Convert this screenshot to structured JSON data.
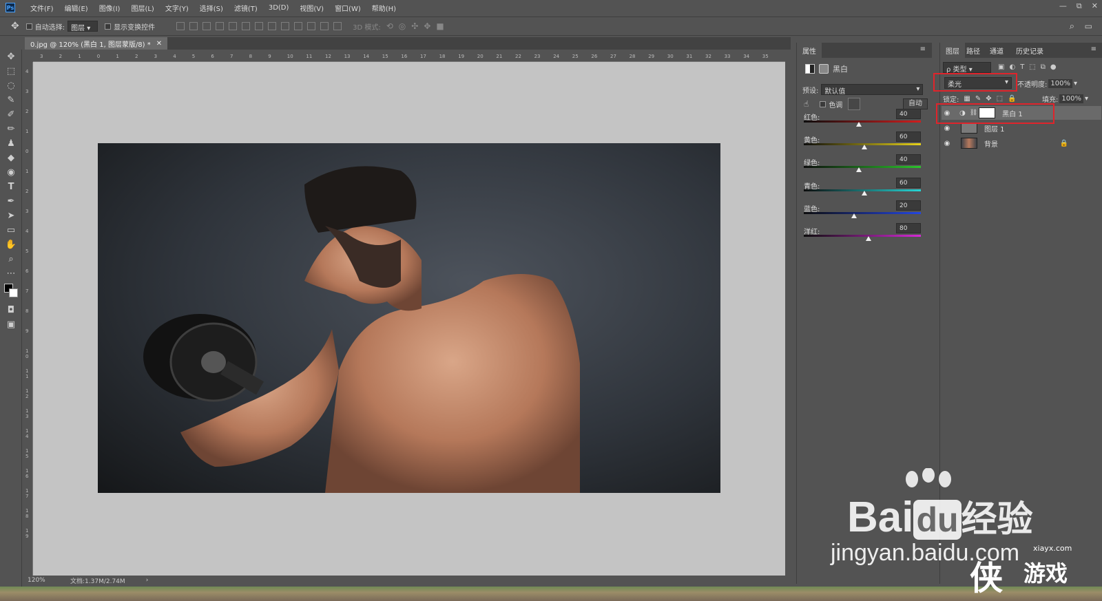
{
  "app": {
    "logo": "Ps"
  },
  "menu": [
    "文件(F)",
    "编辑(E)",
    "图像(I)",
    "图层(L)",
    "文字(Y)",
    "选择(S)",
    "滤镜(T)",
    "3D(D)",
    "视图(V)",
    "窗口(W)",
    "帮助(H)"
  ],
  "window_controls": [
    "—",
    "⧉",
    "✕"
  ],
  "options": {
    "auto_select_label": "自动选择:",
    "auto_select_value": "图层",
    "show_transform_label": "显示变换控件",
    "mode_3d_label": "3D 模式:"
  },
  "document": {
    "tab_title": "0.jpg @ 120% (黑白 1, 图层蒙版/8) *",
    "zoom": "120%",
    "doc_info": "文档:1.37M/2.74M",
    "ruler_top": [
      "3",
      "2",
      "1",
      "0",
      "1",
      "2",
      "3",
      "4",
      "5",
      "6",
      "7",
      "8",
      "9",
      "10",
      "11",
      "12",
      "13",
      "14",
      "15",
      "16",
      "17",
      "18",
      "19",
      "20",
      "21",
      "22",
      "23",
      "24",
      "25",
      "26",
      "27",
      "28",
      "29",
      "30",
      "31",
      "32",
      "33",
      "34",
      "35"
    ],
    "ruler_left": [
      "4",
      "3",
      "2",
      "1",
      "0",
      "1",
      "2",
      "3",
      "4",
      "5",
      "6",
      "7",
      "8",
      "9",
      "1 0",
      "1 1",
      "1 2",
      "1 3",
      "1 4",
      "1 5",
      "1 6",
      "1 7",
      "1 8",
      "1 9"
    ]
  },
  "properties": {
    "tab_label": "属性",
    "adjustment_name": "黑白",
    "preset_label": "预设:",
    "preset_value": "默认值",
    "tint_label": "色调",
    "auto_button": "自动",
    "sliders": [
      {
        "label": "红色:",
        "value": 40,
        "position": 0.47,
        "gradient": [
          "#0d0d0d",
          "#d21d1d"
        ]
      },
      {
        "label": "黄色:",
        "value": 60,
        "position": 0.515,
        "gradient": [
          "#0d0d0d",
          "#e7d21a"
        ]
      },
      {
        "label": "绿色:",
        "value": 40,
        "position": 0.47,
        "gradient": [
          "#0d0d0d",
          "#2bc52b"
        ]
      },
      {
        "label": "青色:",
        "value": 60,
        "position": 0.515,
        "gradient": [
          "#0d0d0d",
          "#27d6d6"
        ]
      },
      {
        "label": "蓝色:",
        "value": 20,
        "position": 0.43,
        "gradient": [
          "#0d0d0d",
          "#2446e2"
        ]
      },
      {
        "label": "洋红:",
        "value": 80,
        "position": 0.555,
        "gradient": [
          "#0d0d0d",
          "#d629d6"
        ]
      }
    ]
  },
  "layers_panel": {
    "tabs": [
      "图层",
      "路径",
      "通道",
      "历史记录"
    ],
    "filter_label": "ρ 类型",
    "blend_mode": "柔光",
    "opacity_label": "不透明度:",
    "opacity_value": "100%",
    "lock_label": "锁定:",
    "fill_label": "填充:",
    "fill_value": "100%",
    "layers": [
      {
        "name": "黑白 1",
        "type": "adjustment",
        "selected": true
      },
      {
        "name": "图层 1",
        "type": "pixel",
        "selected": false
      },
      {
        "name": "背景",
        "type": "background",
        "selected": false,
        "locked": true
      }
    ]
  },
  "watermark": {
    "brand": "Bai",
    "brand_du": "du",
    "brand_cn": "经验",
    "url": "jingyan.baidu.com",
    "site": "xiayx.com",
    "game_cn": "游戏",
    "game_char": "侠"
  },
  "colors": {
    "highlight": "#e0242b",
    "panel_bg": "#535353",
    "canvas_bg": "#c4c4c4"
  }
}
